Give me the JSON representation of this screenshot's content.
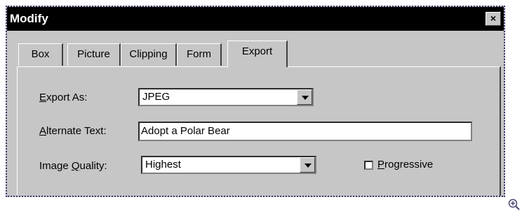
{
  "window": {
    "title": "Modify",
    "close_label": "×"
  },
  "tabs": [
    {
      "label": "Box"
    },
    {
      "label": "Picture"
    },
    {
      "label": "Clipping"
    },
    {
      "label": "Form"
    },
    {
      "label": "Export"
    }
  ],
  "export_as": {
    "label_mnemonic": "E",
    "label_rest": "xport As:",
    "value": "JPEG"
  },
  "alternate_text": {
    "label_mnemonic": "A",
    "label_rest": "lternate Text:",
    "value": "Adopt a Polar Bear"
  },
  "image_quality": {
    "label_pre": "Image ",
    "label_mnemonic": "Q",
    "label_rest": "uality:",
    "value": "Highest"
  },
  "progressive": {
    "label_mnemonic": "P",
    "label_rest": "rogressive",
    "checked": false
  },
  "icons": {
    "zoom": "zoom-in-icon"
  }
}
